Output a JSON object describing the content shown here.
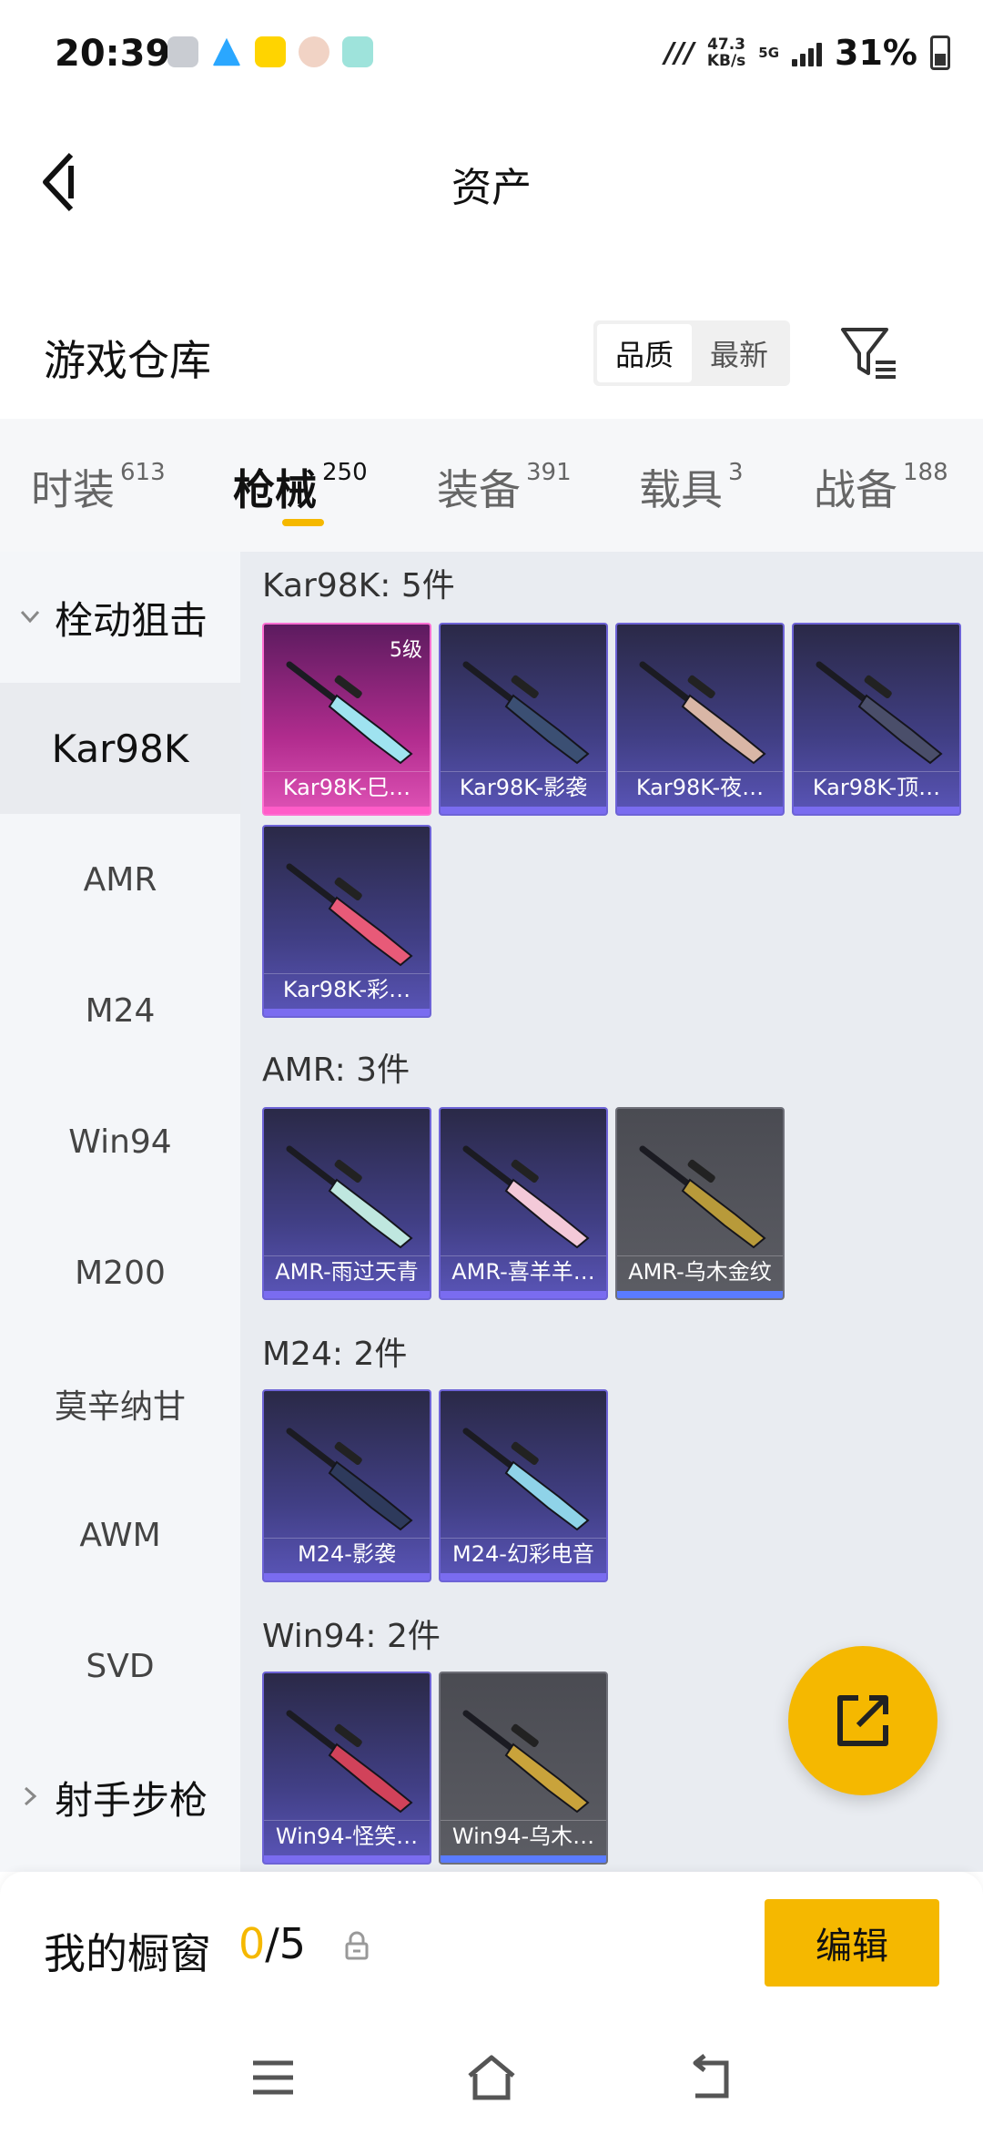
{
  "status_bar": {
    "time": "20:39",
    "net_speed_value": "47.3",
    "net_speed_unit": "KB/s",
    "network": "5G",
    "battery": "31%"
  },
  "header": {
    "title": "资产"
  },
  "warehouse": {
    "title": "游戏仓库",
    "sort_options": [
      "品质",
      "最新"
    ],
    "sort_active": "品质"
  },
  "categories": [
    {
      "label": "时装",
      "count": "613"
    },
    {
      "label": "枪械",
      "count": "250"
    },
    {
      "label": "装备",
      "count": "391"
    },
    {
      "label": "载具",
      "count": "3"
    },
    {
      "label": "战备",
      "count": "188"
    }
  ],
  "active_category": "枪械",
  "sidebar": {
    "group_open": "栓动狙击",
    "items": [
      "Kar98K",
      "AMR",
      "M24",
      "Win94",
      "M200",
      "莫辛纳甘",
      "AWM",
      "SVD"
    ],
    "active_item": "Kar98K",
    "group_closed": "射手步枪"
  },
  "groups": [
    {
      "title": "Kar98K: 5件",
      "items": [
        {
          "name": "Kar98K-巳…",
          "rarity": "pink",
          "level": "5级",
          "gun_color": "#9fe3f0"
        },
        {
          "name": "Kar98K-影袭",
          "rarity": "blue",
          "gun_color": "#3b4f73"
        },
        {
          "name": "Kar98K-夜…",
          "rarity": "blue",
          "gun_color": "#d9b6a6"
        },
        {
          "name": "Kar98K-顶…",
          "rarity": "blue",
          "gun_color": "#4a4e6a"
        },
        {
          "name": "Kar98K-彩…",
          "rarity": "blue",
          "gun_color": "#e85a78"
        }
      ]
    },
    {
      "title": "AMR: 3件",
      "items": [
        {
          "name": "AMR-雨过天青",
          "rarity": "blue",
          "gun_color": "#bfe7df"
        },
        {
          "name": "AMR-喜羊羊…",
          "rarity": "blue",
          "gun_color": "#f3c9d8"
        },
        {
          "name": "AMR-乌木金纹",
          "rarity": "gray",
          "gun_color": "#b89a3a"
        }
      ]
    },
    {
      "title": "M24: 2件",
      "items": [
        {
          "name": "M24-影袭",
          "rarity": "blue",
          "gun_color": "#2e3a5c"
        },
        {
          "name": "M24-幻彩电音",
          "rarity": "blue",
          "gun_color": "#8fd3e8"
        }
      ]
    },
    {
      "title": "Win94: 2件",
      "items": [
        {
          "name": "Win94-怪笑…",
          "rarity": "blue",
          "gun_color": "#d1425a"
        },
        {
          "name": "Win94-乌木…",
          "rarity": "gray",
          "gun_color": "#c9a33b"
        }
      ]
    }
  ],
  "showcase": {
    "label": "我的橱窗",
    "current": "0",
    "total": "/5",
    "edit_label": "编辑"
  },
  "colors": {
    "accent": "#f5b800",
    "blue_card": "#413f85",
    "pink_card": "#b12c8e",
    "gray_card": "#5c5d64"
  }
}
